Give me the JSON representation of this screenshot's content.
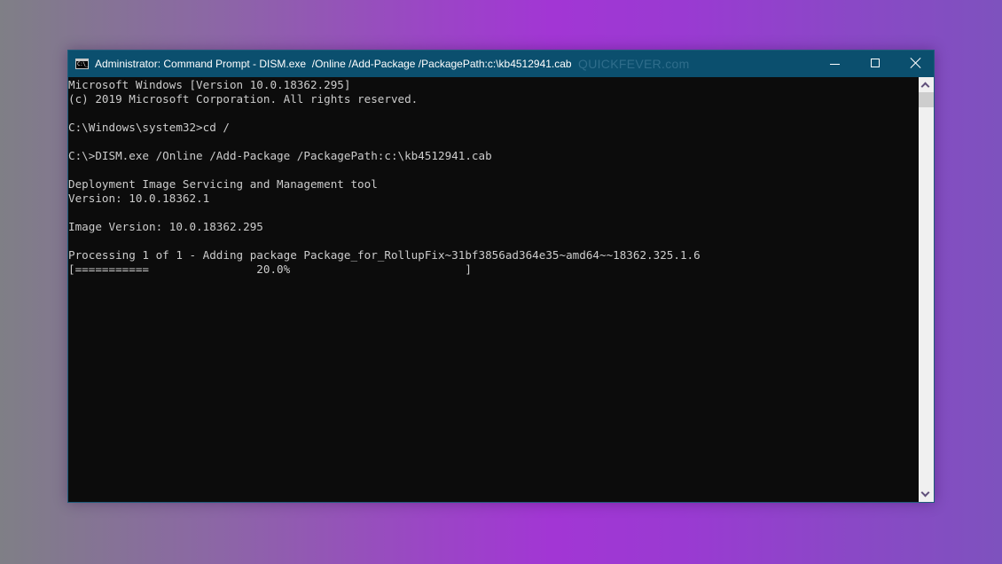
{
  "window": {
    "title": "Administrator: Command Prompt - DISM.exe  /Online /Add-Package /PackagePath:c:\\kb4512941.cab",
    "watermark": "QUICKFEVER.com",
    "icon_label": "C:\\_",
    "controls": {
      "minimize": "minimize-icon",
      "maximize": "maximize-icon",
      "close": "close-icon"
    }
  },
  "console": {
    "lines": [
      "Microsoft Windows [Version 10.0.18362.295]",
      "(c) 2019 Microsoft Corporation. All rights reserved.",
      "",
      "C:\\Windows\\system32>cd /",
      "",
      "C:\\>DISM.exe /Online /Add-Package /PackagePath:c:\\kb4512941.cab",
      "",
      "Deployment Image Servicing and Management tool",
      "Version: 10.0.18362.1",
      "",
      "Image Version: 10.0.18362.295",
      "",
      "Processing 1 of 1 - Adding package Package_for_RollupFix~31bf3856ad364e35~amd64~~18362.325.1.6",
      "[===========                20.0%                          ]"
    ],
    "progress_percent": 20.0
  },
  "colors": {
    "titlebar": "#0b4f6e",
    "console_bg": "#0c0c0c",
    "console_text": "#cccccc"
  }
}
